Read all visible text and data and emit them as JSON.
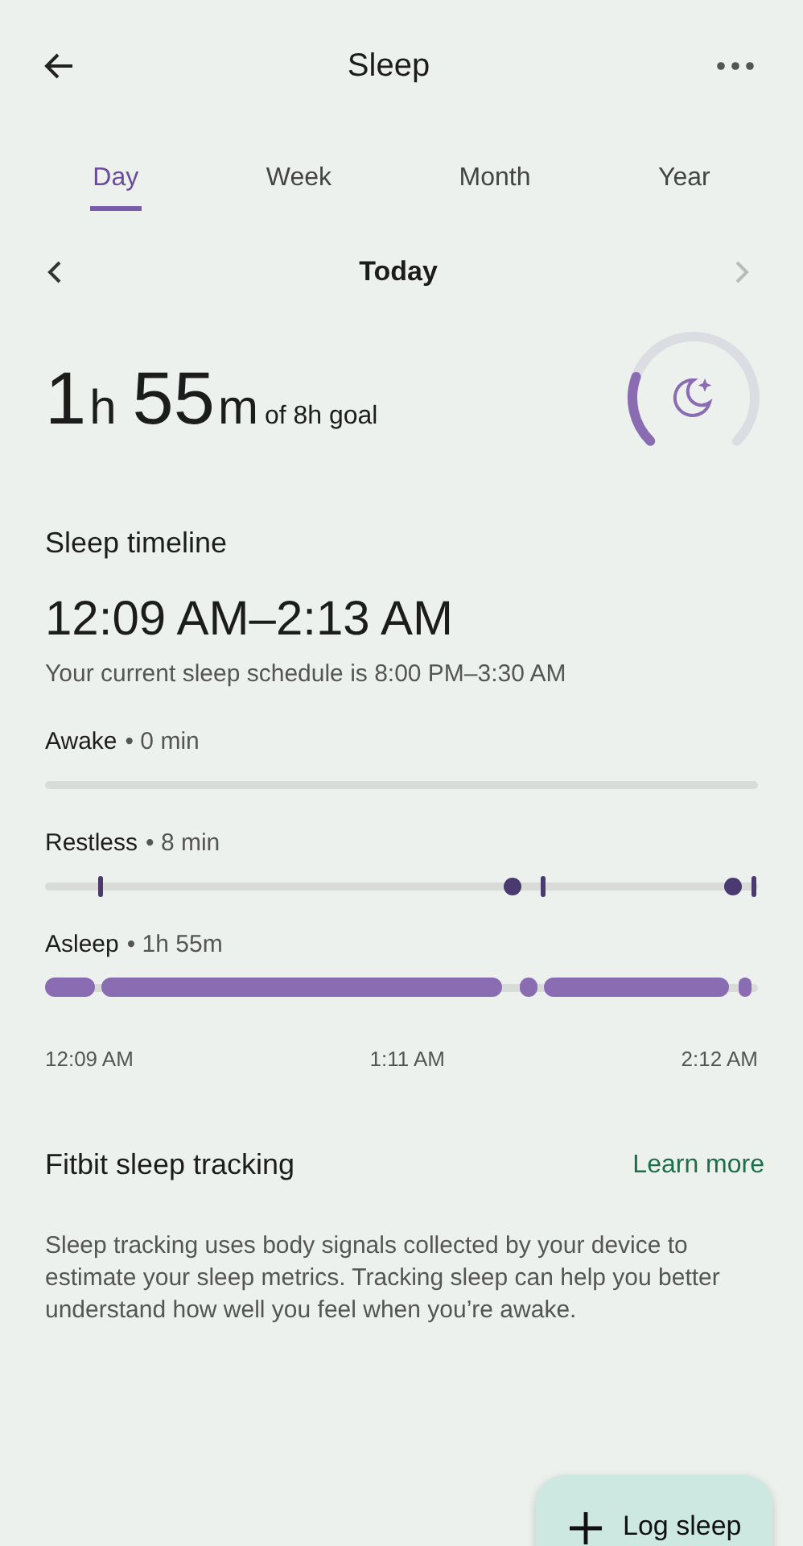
{
  "header": {
    "title": "Sleep"
  },
  "tabs": [
    {
      "label": "Day",
      "selected": true
    },
    {
      "label": "Week",
      "selected": false
    },
    {
      "label": "Month",
      "selected": false
    },
    {
      "label": "Year",
      "selected": false
    }
  ],
  "date_nav": {
    "label": "Today",
    "next_disabled": true
  },
  "duration": {
    "hours": "1",
    "hours_unit": "h",
    "minutes": "55",
    "minutes_unit": "m",
    "goal": "of 8h goal"
  },
  "timeline": {
    "title": "Sleep timeline",
    "range": "12:09 AM–2:13 AM",
    "schedule": "Your current sleep schedule is 8:00 PM–3:30 AM",
    "stages": [
      {
        "kind": "awake",
        "name": "Awake",
        "value": "• 0 min"
      },
      {
        "kind": "restless",
        "name": "Restless",
        "value": "• 8 min"
      },
      {
        "kind": "asleep",
        "name": "Asleep",
        "value": "• 1h 55m"
      }
    ],
    "axis": [
      "12:09 AM",
      "1:11 AM",
      "2:12 AM"
    ]
  },
  "info": {
    "title": "Fitbit sleep tracking",
    "link": "Learn more",
    "text": "Sleep tracking uses body signals collected by your device to estimate your sleep metrics. Tracking sleep can help you better understand how well you feel when you’re awake."
  },
  "fab": {
    "label": "Log sleep"
  }
}
